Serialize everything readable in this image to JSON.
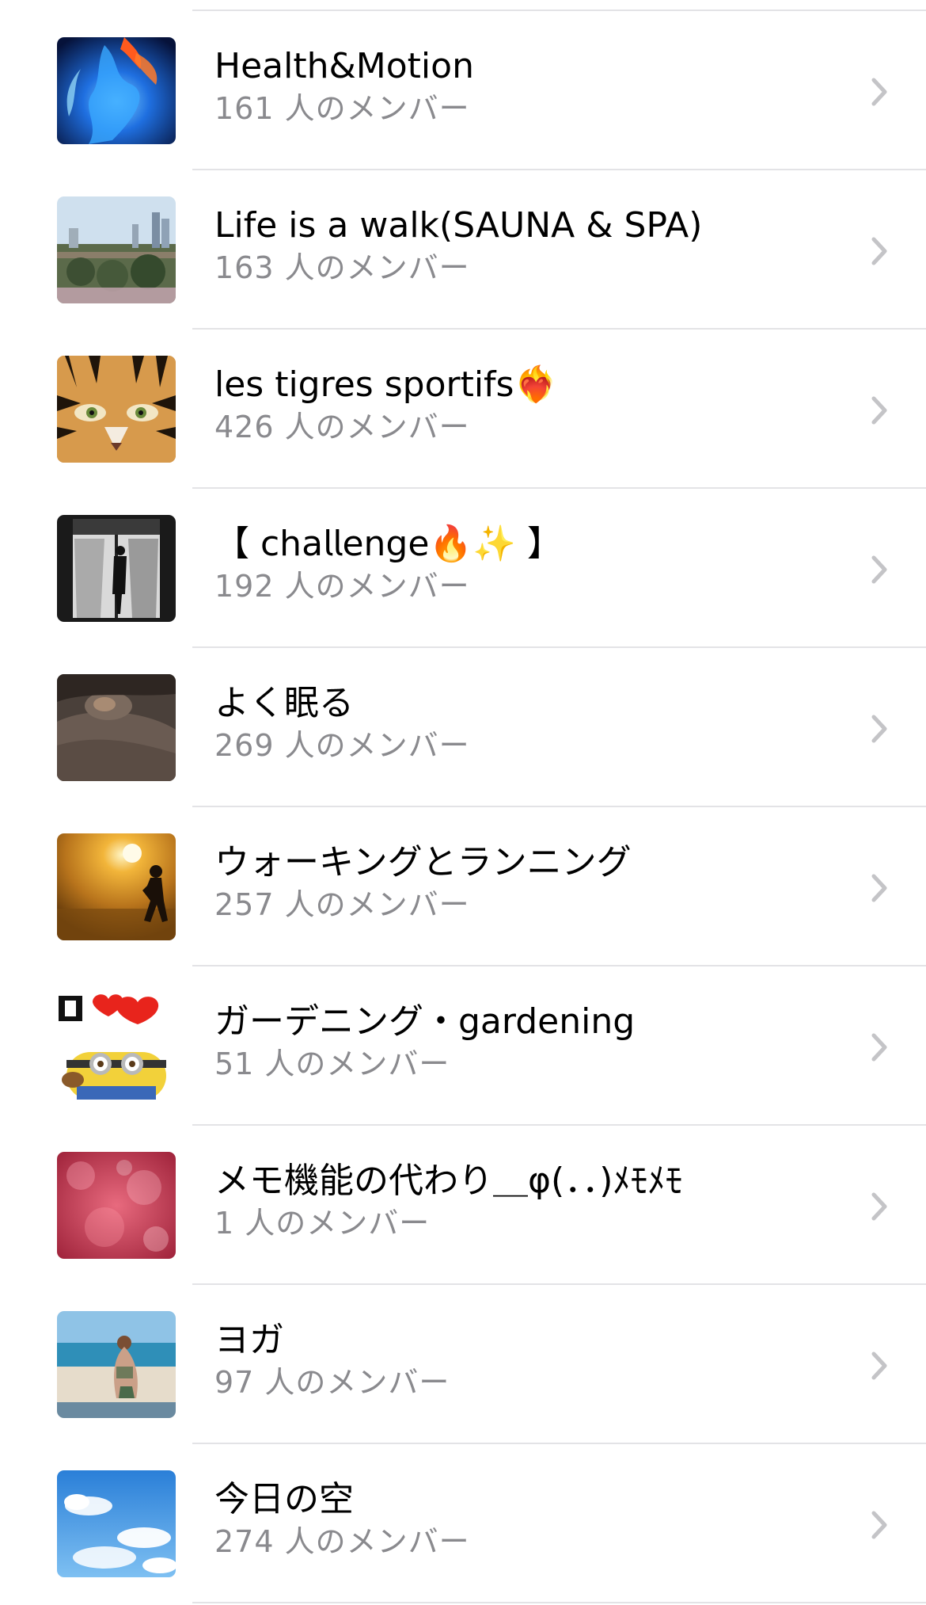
{
  "groups": [
    {
      "title": "Health&Motion",
      "members": "161 人のメンバー",
      "icon": "blue-fire-thumbnail"
    },
    {
      "title": "Life is a walk(SAUNA & SPA)",
      "members": "163 人のメンバー",
      "icon": "city-park-thumbnail"
    },
    {
      "title": "les tigres sportifs❤️‍🔥",
      "members": "426 人のメンバー",
      "icon": "tiger-face-thumbnail"
    },
    {
      "title": "【 𝖼𝗁𝖺𝗅𝗅𝖾𝗇𝗀𝖾🔥✨ 】",
      "members": "192 人のメンバー",
      "icon": "window-figure-thumbnail"
    },
    {
      "title": "よく眠る",
      "members": "269 人のメンバー",
      "icon": "sleeping-thumbnail"
    },
    {
      "title": "ウォーキングとランニング",
      "members": "257 人のメンバー",
      "icon": "runner-sunset-thumbnail"
    },
    {
      "title": "ガーデニング・gardening",
      "members": "51 人のメンバー",
      "icon": "minion-heart-thumbnail"
    },
    {
      "title": "メモ機能の代わり＿φ(．．)ﾒﾓﾒﾓ",
      "members": "1 人のメンバー",
      "icon": "pink-bokeh-thumbnail"
    },
    {
      "title": "ヨガ",
      "members": "97 人のメンバー",
      "icon": "yoga-beach-thumbnail"
    },
    {
      "title": "今日の空",
      "members": "274 人のメンバー",
      "icon": "sky-clouds-thumbnail"
    }
  ],
  "colors": {
    "title_text": "#000000",
    "subtitle_text": "#8a8a8e",
    "divider": "#e3e3e6",
    "chevron": "#c4c4c7"
  },
  "chevron_icon": "chevron-right-icon"
}
